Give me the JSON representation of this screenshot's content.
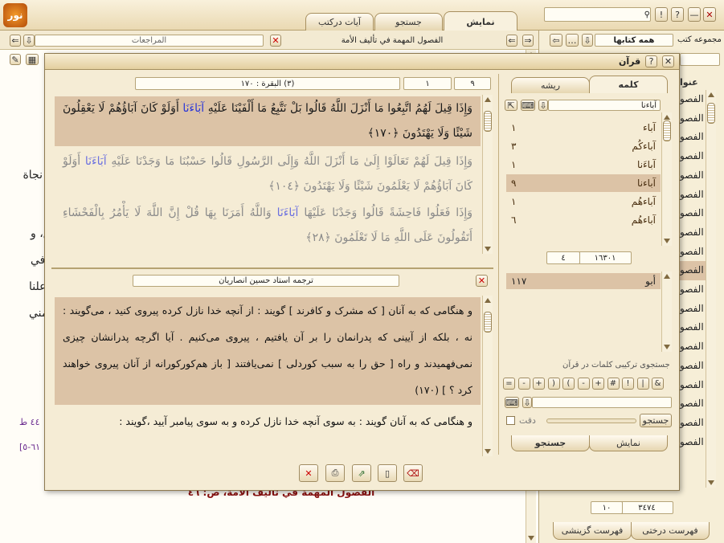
{
  "app": {
    "logo_text": "نور"
  },
  "top_tabs": {
    "display": "نمایش",
    "search": "جستجو",
    "verses": "آیات درکتب"
  },
  "left_book": {
    "title": "الفصول المهمة في تأليف الأمة",
    "references_label": "المراجعات",
    "footer": "الفصول المهمة في تأليف الأمة، ص: ٤٦",
    "fragments": [
      "نجاة",
      "اع، و",
      "اد في",
      "علنا",
      "مني"
    ],
    "refs": [
      "٤٤ ط",
      "[٦١-٥"
    ]
  },
  "right_panel": {
    "collection_label": "مجموعه کتب",
    "collection_value": "همه کتابها",
    "title_label": "عنوا",
    "items": [
      "الفصو",
      "الفصو",
      "الفصو",
      "الفصو",
      "الفصو",
      "الفصو",
      "الفصو",
      "الفصو",
      "الفصو",
      "الفصو",
      "الفصو",
      "الفصو",
      "الفصو",
      "الفصو",
      "الفصو",
      "الفصو",
      "الفصو",
      "الفصو",
      "الفصو"
    ],
    "count_left": "١٠",
    "count_right": "٣٤٧٤",
    "tab_tree": "فهرست درختی",
    "tab_select": "فهرست گزینشی"
  },
  "dialog": {
    "title": "قرآن",
    "surah_field": "(٣) البقرة : ١٧٠",
    "num1": "١",
    "num2": "٩",
    "verse1": "وَإِذَا قِيلَ لَهُمُ اتَّبِعُوا مَا أَنْزَلَ اللَّهُ قَالُوا بَلْ نَتَّبِعُ مَا أَلْفَيْنَا عَلَيْهِ",
    "verse1_hl": "آبَاءَنَا",
    "verse1_end": "أَوَلَوْ كَانَ آبَاؤُهُمْ لَا يَعْقِلُونَ شَيْئًا وَلَا يَهْتَدُونَ ﴿١٧٠﴾",
    "verse2": "وَإِذَا قِيلَ لَهُمْ تَعَالَوْا إِلَىٰ مَا أَنْزَلَ اللَّهُ وَإِلَى الرَّسُولِ قَالُوا حَسْبُنَا مَا وَجَدْنَا عَلَيْهِ",
    "verse2_hl": "آبَاءَنَا",
    "verse2_end": "أَوَلَوْ كَانَ آبَاؤُهُمْ لَا يَعْلَمُونَ شَيْئًا وَلَا يَهْتَدُونَ ﴿١٠٤﴾",
    "verse3": "وَإِذَا فَعَلُوا فَاحِشَةً قَالُوا وَجَدْنَا عَلَيْهَا",
    "verse3_hl": "آبَاءَنَا",
    "verse3_end": "وَاللَّهُ أَمَرَنَا بِهَا قُلْ إِنَّ اللَّهَ لَا يَأْمُرُ بِالْفَحْشَاءِ أَتَقُولُونَ عَلَى اللَّهِ مَا لَا تَعْلَمُونَ ﴿٢٨﴾",
    "translator": "ترجمه استاد حسین انصاریان",
    "translation1": "و هنگامی که به آنان [ که مشرک و کافرند ] گویند : از آنچه خدا نازل کرده پیروی کنید ، می‌گویند : نه ، بلکه از آیینی که پدرانمان را بر آن یافتیم ، پیروی می‌کنیم . آیا اگرچه پدرانشان چیزی نمی‌فهمیدند و راه [ حق را به سبب کوردلی ] نمی‌یافتند [ باز هم‌کورکورانه از آنان پیروی خواهند کرد ؟ ] (١٧٠)",
    "translation2": "و هنگامی که به آنان گویند : به سوی آنچه خدا نازل کرده و به سوی پیامبر آیید ،گویند :",
    "tab_word": "کلمه",
    "tab_root": "ریشه",
    "search_word": "آباءنا",
    "words": [
      {
        "w": "آباء",
        "c": "١"
      },
      {
        "w": "آباءكُم",
        "c": "٣"
      },
      {
        "w": "آباءَنا",
        "c": "١"
      },
      {
        "w": "آباءنا",
        "c": "٩"
      },
      {
        "w": "آباءهُم",
        "c": "١"
      },
      {
        "w": "آباءهُم",
        "c": "٦"
      }
    ],
    "stats_left": "٤",
    "stats_right": "١٦٣٠١",
    "root_item": "أبو",
    "root_count": "١١٧",
    "combo_label": "جستجوی ترکیبی کلمات در قرآن",
    "ops": [
      "&",
      "|",
      "!",
      "#",
      "+",
      "-",
      "(",
      ")",
      "+",
      "-",
      "="
    ],
    "exact_label": "دقت",
    "search_btn": "جستجو",
    "bottom_tab_display": "نمایش",
    "bottom_tab_search": "جستجو"
  }
}
